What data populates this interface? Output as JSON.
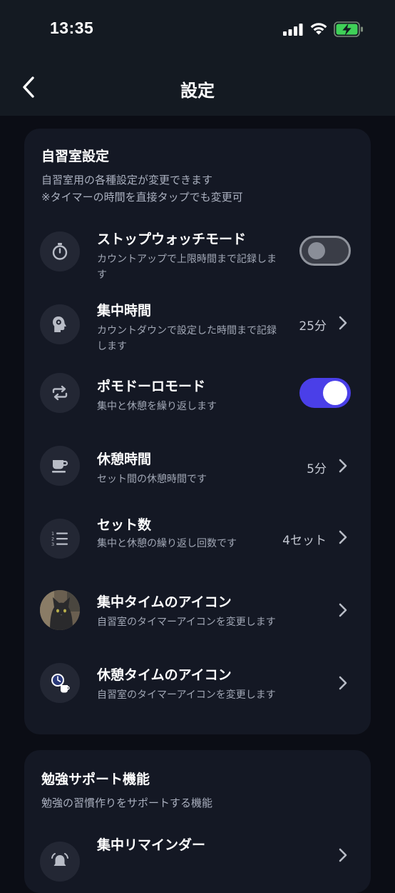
{
  "status_bar": {
    "time": "13:35"
  },
  "header": {
    "title": "設定"
  },
  "study_room": {
    "title": "自習室設定",
    "desc_line1": "自習室用の各種設定が変更できます",
    "desc_line2": "※タイマーの時間を直接タップでも変更可",
    "rows": [
      {
        "title": "ストップウォッチモード",
        "sub": "カウントアップで上限時間まで記録します",
        "toggle": false,
        "icon": "stopwatch-icon"
      },
      {
        "title": "集中時間",
        "sub": "カウントダウンで設定した時間まで記録します",
        "value": "25分",
        "icon": "brain-head-icon"
      },
      {
        "title": "ポモドーロモード",
        "sub": "集中と休憩を繰り返します",
        "toggle": true,
        "icon": "repeat-icon"
      },
      {
        "title": "休憩時間",
        "sub": "セット間の休憩時間です",
        "value": "5分",
        "icon": "coffee-cup-icon"
      },
      {
        "title": "セット数",
        "sub": "集中と休憩の繰り返し回数です",
        "value": "4セット",
        "icon": "numbered-list-icon"
      },
      {
        "title": "集中タイムのアイコン",
        "sub": "自習室のタイマーアイコンを変更します",
        "icon": "cat-avatar"
      },
      {
        "title": "休憩タイムのアイコン",
        "sub": "自習室のタイマーアイコンを変更します",
        "icon": "clock-cup-icon"
      }
    ]
  },
  "study_support": {
    "title": "勉強サポート機能",
    "desc": "勉強の習慣作りをサポートする機能",
    "rows": [
      {
        "title": "集中リマインダー",
        "icon": "alarm-icon"
      }
    ]
  },
  "colors": {
    "accent": "#4a3fe8",
    "card": "#141824",
    "background": "#0b0d15"
  }
}
